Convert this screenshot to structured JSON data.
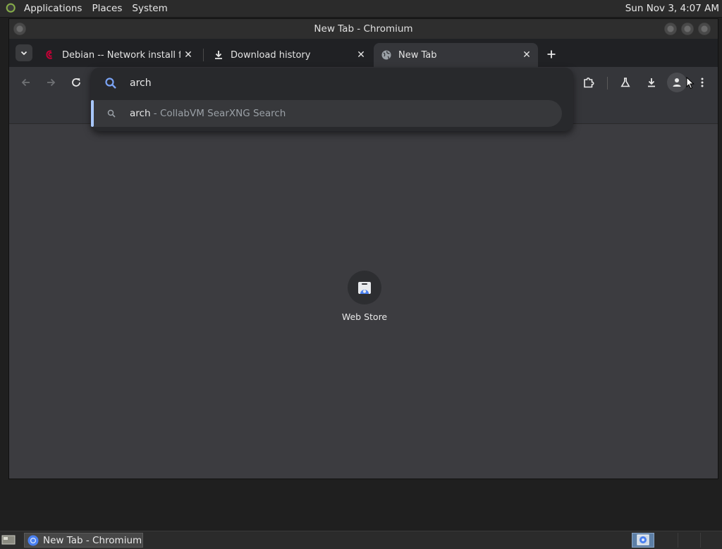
{
  "top_panel": {
    "menus": [
      "Applications",
      "Places",
      "System"
    ],
    "clock": "Sun Nov  3,  4:07 AM"
  },
  "window": {
    "title": "New Tab - Chromium"
  },
  "tabs": [
    {
      "label": "Debian -- Network install fro",
      "icon": "debian-icon",
      "active": false
    },
    {
      "label": "Download history",
      "icon": "download-icon",
      "active": false
    },
    {
      "label": "New Tab",
      "icon": "globe-icon",
      "active": true
    }
  ],
  "omnibox": {
    "query": "arch",
    "suggestion": {
      "main": "arch",
      "description": " - CollabVM SearXNG Search"
    }
  },
  "shortcuts": [
    {
      "label": "Web Store",
      "icon": "web-store-icon"
    }
  ],
  "taskbar": {
    "window_label": "New Tab - Chromium"
  },
  "colors": {
    "accent": "#a8c7fa",
    "search_icon": "#7aa3f5",
    "content_bg": "#3c3c40",
    "debian_red": "#c70036"
  }
}
